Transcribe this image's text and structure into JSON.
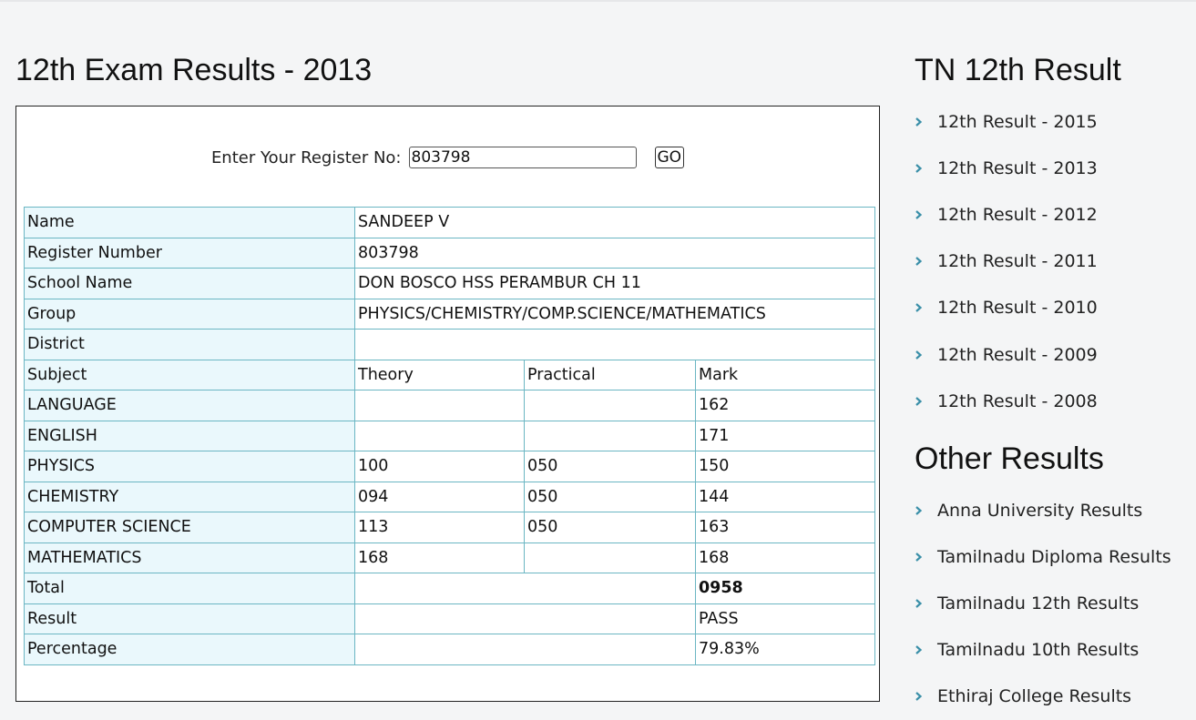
{
  "main": {
    "title": "12th Exam Results - 2013",
    "form": {
      "label": "Enter Your Register No:",
      "register_value": "803798",
      "go_label": "GO"
    },
    "info_rows": [
      {
        "label": "Name",
        "value": "SANDEEP V"
      },
      {
        "label": "Register Number",
        "value": "803798"
      },
      {
        "label": "School Name",
        "value": "DON BOSCO HSS PERAMBUR CH 11"
      },
      {
        "label": "Group",
        "value": "PHYSICS/CHEMISTRY/COMP.SCIENCE/MATHEMATICS"
      },
      {
        "label": "District",
        "value": ""
      }
    ],
    "marks_header": {
      "subject": "Subject",
      "theory": "Theory",
      "practical": "Practical",
      "mark": "Mark"
    },
    "marks": [
      {
        "subject": "LANGUAGE",
        "theory": "",
        "practical": "",
        "mark": "162"
      },
      {
        "subject": "ENGLISH",
        "theory": "",
        "practical": "",
        "mark": "171"
      },
      {
        "subject": "PHYSICS",
        "theory": "100",
        "practical": "050",
        "mark": "150"
      },
      {
        "subject": "CHEMISTRY",
        "theory": "094",
        "practical": "050",
        "mark": "144"
      },
      {
        "subject": "COMPUTER SCIENCE",
        "theory": "113",
        "practical": "050",
        "mark": "163"
      },
      {
        "subject": "MATHEMATICS",
        "theory": "168",
        "practical": "",
        "mark": "168"
      }
    ],
    "summary": [
      {
        "label": "Total",
        "value": "0958"
      },
      {
        "label": "Result",
        "value": "PASS"
      },
      {
        "label": "Percentage",
        "value": "79.83%"
      }
    ]
  },
  "sidebar": {
    "tn_heading": "TN 12th Result",
    "tn_links": [
      "12th Result - 2015",
      "12th Result - 2013",
      "12th Result - 2012",
      "12th Result - 2011",
      "12th Result - 2010",
      "12th Result - 2009",
      "12th Result - 2008"
    ],
    "other_heading": "Other Results",
    "other_links": [
      "Anna University Results",
      "Tamilnadu Diploma Results",
      "Tamilnadu 12th Results",
      "Tamilnadu 10th Results",
      "Ethiraj College Results"
    ],
    "icon": "chevron-right-icon"
  },
  "colors": {
    "table_border": "#6bb6c3",
    "label_bg": "#eaf8fc",
    "chevron": "#3a8fa8",
    "page_bg": "#f4f5f6"
  }
}
